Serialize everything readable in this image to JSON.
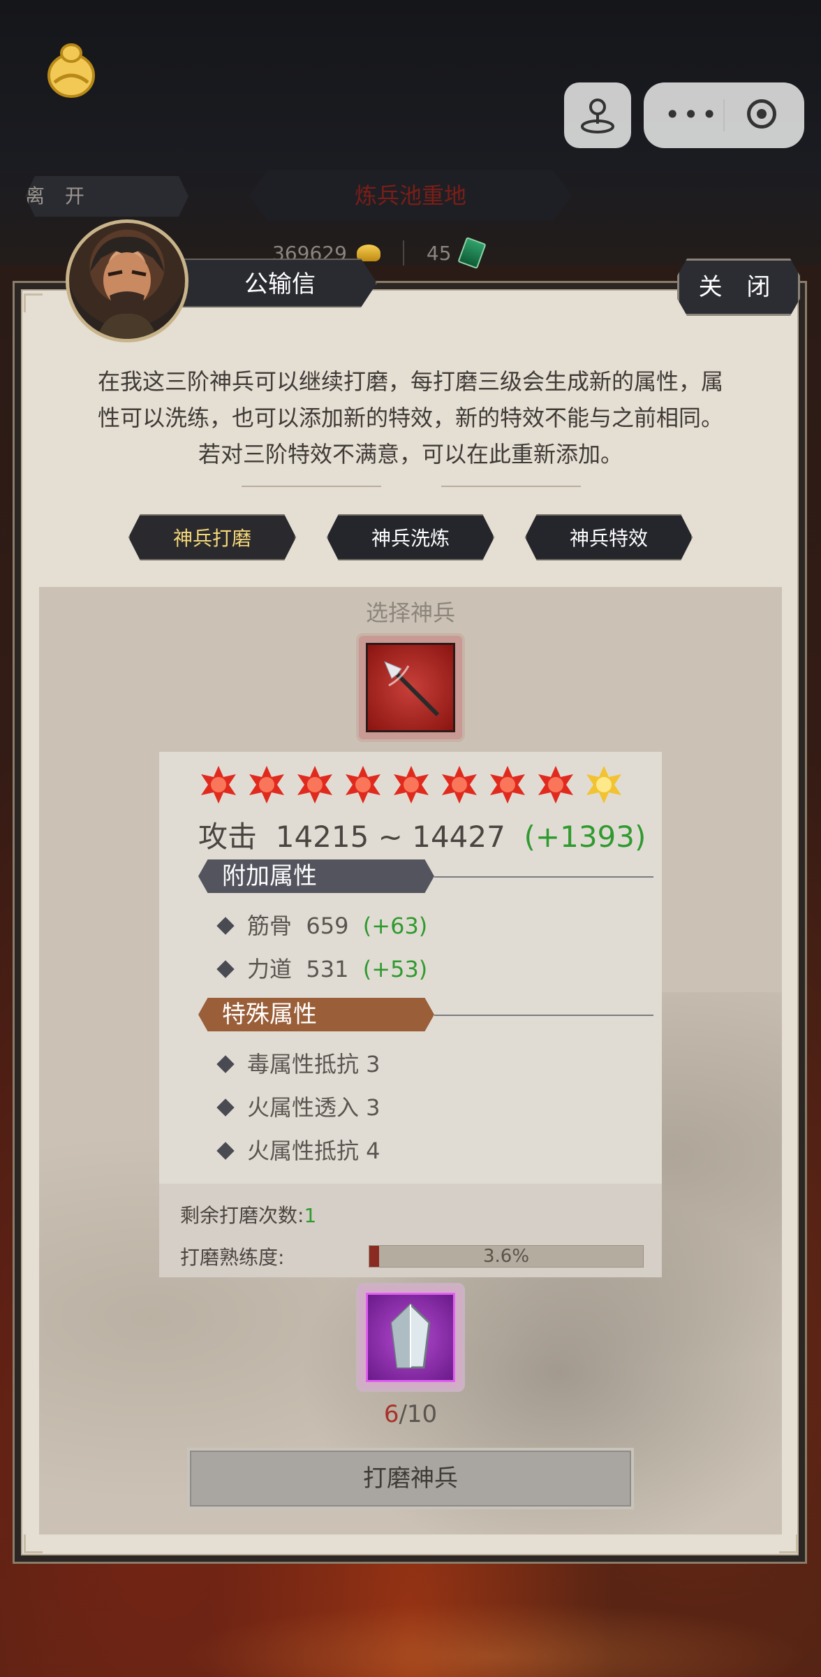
{
  "top": {
    "leave_label": "离 开",
    "location_title": "炼兵池重地",
    "gold_amount": "369629",
    "jade_amount": "45"
  },
  "npc": {
    "name": "公输信",
    "close_label": "关 闭",
    "dialog": [
      "在我这三阶神兵可以继续打磨，每打磨三级会生成新的属性，属",
      "性可以洗练，也可以添加新的特效，新的特效不能与之前相同。",
      "若对三阶特效不满意，可以在此重新添加。"
    ]
  },
  "tabs": [
    {
      "label": "神兵打磨",
      "active": true
    },
    {
      "label": "神兵洗炼",
      "active": false
    },
    {
      "label": "神兵特效",
      "active": false
    }
  ],
  "weapon": {
    "select_label": "选择神兵",
    "stars": {
      "red": 8,
      "gold": 1
    },
    "attack_label": "攻击",
    "attack_range": "14215 ~ 14427",
    "attack_bonus": "(+1393)",
    "extra_title": "附加属性",
    "extra_attrs": [
      {
        "name": "筋骨",
        "value": "659",
        "bonus": "(+63)"
      },
      {
        "name": "力道",
        "value": "531",
        "bonus": "(+53)"
      }
    ],
    "special_title": "特殊属性",
    "special_attrs": [
      "毒属性抵抗 3",
      "火属性透入 3",
      "火属性抵抗 4"
    ],
    "remain_label": "剩余打磨次数:",
    "remain_count": "1",
    "proficiency_label": "打磨熟练度:",
    "proficiency_text": "3.6%",
    "proficiency_fraction": 0.036
  },
  "material": {
    "have": "6",
    "need": "/10"
  },
  "action": {
    "polish_label": "打磨神兵"
  },
  "colors": {
    "bonus_green": "#2f9a2f",
    "tab_active_text": "#f4d77a",
    "extra_header": "#53545e",
    "special_header": "#9a5e38"
  }
}
